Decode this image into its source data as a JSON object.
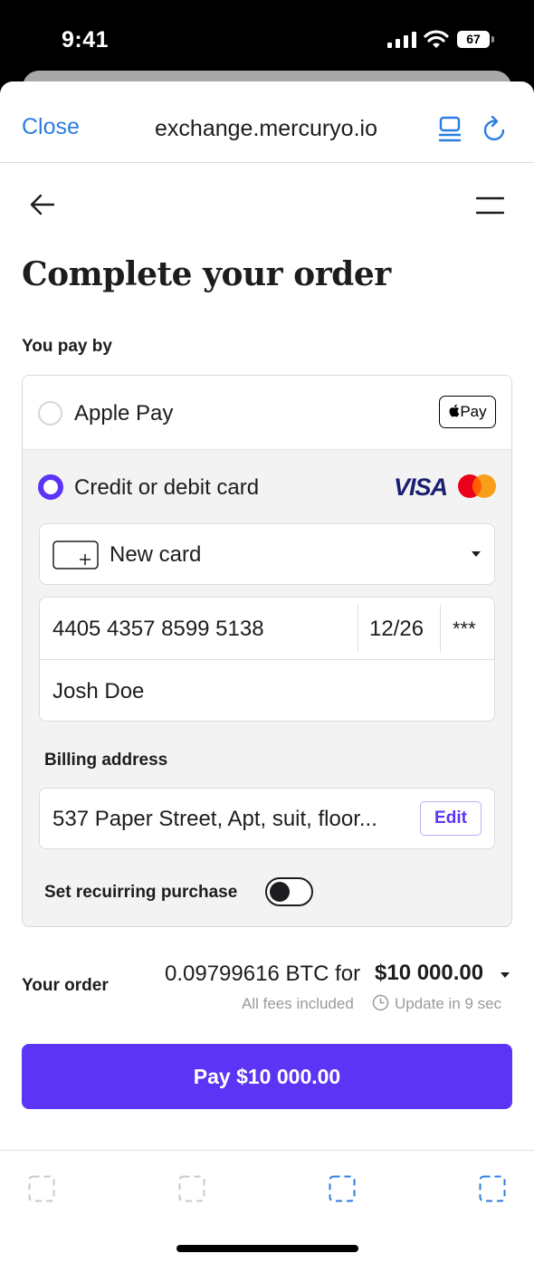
{
  "status_bar": {
    "time": "9:41",
    "battery": "67"
  },
  "browser": {
    "close_label": "Close",
    "domain": "exchange.mercuryo.io"
  },
  "page": {
    "title": "Complete your order"
  },
  "payment": {
    "section_label": "You pay by",
    "apple_pay_label": "Apple Pay",
    "apple_pay_badge": "Pay",
    "card_option_label": "Credit or debit card",
    "visa_label": "VISA",
    "card_select": "New card",
    "card_number": "4405 4357 8599 5138",
    "expiry": "12/26",
    "cvv": "***",
    "holder_name": "Josh Doe",
    "billing_label": "Billing address",
    "billing_address": "537 Paper Street, Apt, suit, floor...",
    "edit_label": "Edit",
    "recurring_label": "Set recuirring purchase",
    "recurring_enabled": false
  },
  "order": {
    "label": "Your order",
    "amount": "0.09799616 BTC for",
    "total": "$10 000.00",
    "fees": "All fees included",
    "update": "Update in 9 sec"
  },
  "pay_button": {
    "label": "Pay $10 000.00"
  },
  "colors": {
    "accent": "#5b34f5",
    "link": "#2b7de0",
    "visa": "#1a1f71",
    "mc_red": "#eb001b",
    "mc_orange": "#f79e1b"
  },
  "icons": [
    "signal-icon",
    "wifi-icon",
    "tabs-icon",
    "reload-icon",
    "back-arrow-icon",
    "menu-icon",
    "card-outline-icon",
    "chevron-down-icon",
    "clock-icon"
  ]
}
